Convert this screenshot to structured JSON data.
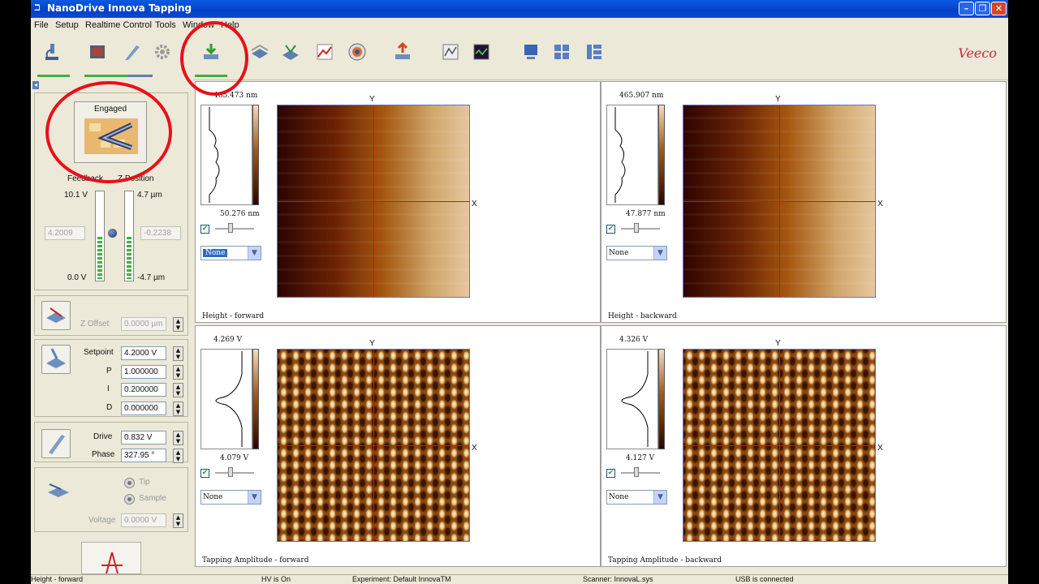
{
  "window": {
    "title": "NanoDrive Innova Tapping"
  },
  "menu": [
    "File",
    "Setup",
    "Realtime Control",
    "Tools",
    "Window",
    "Help"
  ],
  "toolbar": {
    "logo": "Veeco",
    "buttons": [
      "microscope-icon",
      "camera-icon",
      "probe-icon",
      "gear-icon",
      "engage-icon",
      "stage-icon",
      "scan-icon",
      "spectrum-icon",
      "target-icon",
      "withdraw-icon",
      "scope-icon",
      "oscilloscope-icon",
      "computer-icon",
      "layout-icon",
      "layout-grid-icon"
    ]
  },
  "status_panel": {
    "engaged_label": "Engaged",
    "feedback_label": "Feedback",
    "zposition_label": "Z Position",
    "feedback_top": "10.1 V",
    "feedback_bottom": "0.0 V",
    "feedback_value": "4.2009",
    "z_top": "4.7 µm",
    "z_bottom": "-4.7 µm",
    "z_value": "-0.2238"
  },
  "controls": {
    "z_offset_label": "Z Offset",
    "z_offset_value": "0.0000 µm",
    "setpoint_label": "Setpoint",
    "setpoint_value": "4.2000 V",
    "p_label": "P",
    "p_value": "1.000000",
    "i_label": "I",
    "i_value": "0.200000",
    "d_label": "D",
    "d_value": "0.000000",
    "drive_label": "Drive",
    "drive_value": "0.832 V",
    "phase_label": "Phase",
    "phase_value": "327.95 °",
    "tip_label": "Tip",
    "sample_label": "Sample",
    "voltage_label": "Voltage",
    "voltage_value": "0.0000 V"
  },
  "panels": [
    {
      "caption": "Height - forward",
      "top": "465.473 nm",
      "bottom": "50.276 nm",
      "filter": "None"
    },
    {
      "caption": "Height - backward",
      "top": "465.907 nm",
      "bottom": "47.877 nm",
      "filter": "None"
    },
    {
      "caption": "Tapping Amplitude - forward",
      "top": "4.269 V",
      "bottom": "4.079 V",
      "filter": "None"
    },
    {
      "caption": "Tapping Amplitude - backward",
      "top": "4.326 V",
      "bottom": "4.127 V",
      "filter": "None"
    }
  ],
  "axis": {
    "x": "X",
    "y": "Y"
  },
  "statusbar": {
    "view": "Height - forward",
    "hv": "HV is On",
    "experiment": "Experiment: Default InnovaTM",
    "scanner": "Scanner: InnovaL.sys",
    "usb": "USB is connected"
  },
  "colors": {
    "title_blue": "#0441c9",
    "highlight_red": "#e8101a",
    "accent_green": "#3cb33c"
  }
}
